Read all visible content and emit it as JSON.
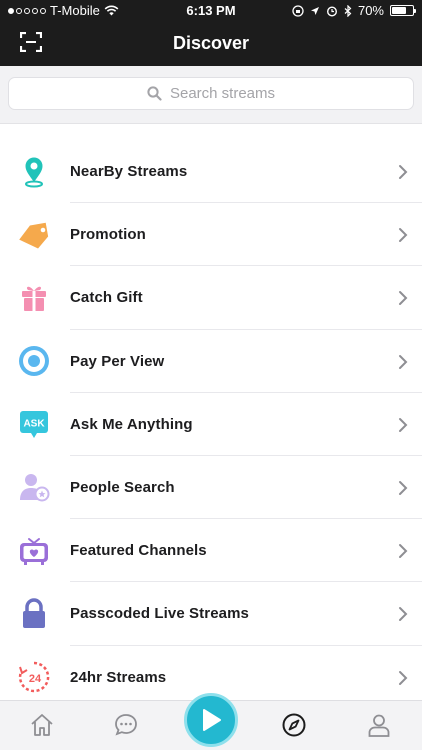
{
  "status_bar": {
    "carrier": "T-Mobile",
    "time": "6:13 PM",
    "battery": "70%",
    "battery_level": 0.7
  },
  "header": {
    "title": "Discover"
  },
  "search": {
    "placeholder": "Search streams"
  },
  "menu": {
    "items": [
      {
        "label": "NearBy Streams",
        "icon": "location-pin-icon",
        "color": "#21c3b9"
      },
      {
        "label": "Promotion",
        "icon": "tag-icon",
        "color": "#f5a94c"
      },
      {
        "label": "Catch Gift",
        "icon": "gift-icon",
        "color": "#f48fb1"
      },
      {
        "label": "Pay Per View",
        "icon": "target-icon",
        "color": "#5ab7ef"
      },
      {
        "label": "Ask Me Anything",
        "icon": "ask-bubble-icon",
        "color": "#35c6dd"
      },
      {
        "label": "People Search",
        "icon": "person-search-icon",
        "color": "#c9b7ef"
      },
      {
        "label": "Featured Channels",
        "icon": "tv-heart-icon",
        "color": "#9a6fd8"
      },
      {
        "label": "Passcoded Live Streams",
        "icon": "lock-icon",
        "color": "#6b71c2"
      },
      {
        "label": "24hr Streams",
        "icon": "24hr-icon",
        "color": "#f25c5c",
        "badge_text": "24"
      }
    ]
  },
  "tabbar": {
    "active": "discover",
    "accent": "#23b8d0"
  }
}
